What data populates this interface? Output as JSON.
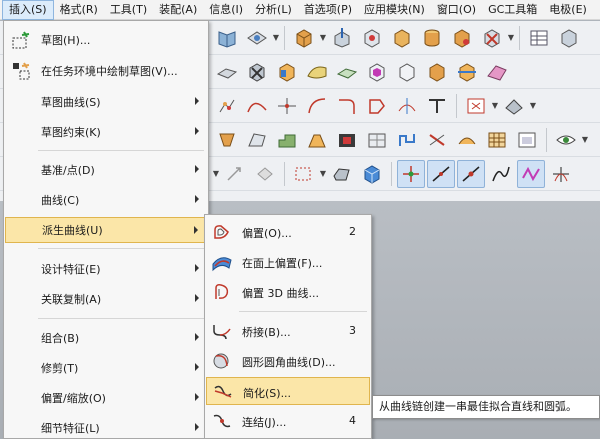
{
  "menubar": {
    "items": [
      "插入(S)",
      "格式(R)",
      "工具(T)",
      "装配(A)",
      "信息(I)",
      "分析(L)",
      "首选项(P)",
      "应用模块(N)",
      "窗口(O)",
      "GC工具箱",
      "电极(E)"
    ]
  },
  "insert_menu": {
    "items": [
      {
        "label": "草图(H)...",
        "icon": "sketch-icon"
      },
      {
        "label": "在任务环境中绘制草图(V)...",
        "icon": "task-sketch-icon"
      },
      {
        "label": "草图曲线(S)",
        "icon": ""
      },
      {
        "label": "草图约束(K)",
        "icon": ""
      },
      {
        "label": "基准/点(D)",
        "icon": ""
      },
      {
        "label": "曲线(C)",
        "icon": ""
      },
      {
        "label": "派生曲线(U)",
        "icon": ""
      },
      {
        "label": "设计特征(E)",
        "icon": ""
      },
      {
        "label": "关联复制(A)",
        "icon": ""
      },
      {
        "label": "组合(B)",
        "icon": ""
      },
      {
        "label": "修剪(T)",
        "icon": ""
      },
      {
        "label": "偏置/缩放(O)",
        "icon": ""
      },
      {
        "label": "细节特征(L)",
        "icon": ""
      }
    ]
  },
  "derived_curve_menu": {
    "items": [
      {
        "label": "偏置(O)...",
        "shortcut": "2",
        "icon": "offset-curve-icon"
      },
      {
        "label": "在面上偏置(F)...",
        "shortcut": "",
        "icon": "offset-in-face-icon"
      },
      {
        "label": "偏置 3D 曲线...",
        "shortcut": "",
        "icon": "offset-3d-curve-icon"
      },
      {
        "label": "桥接(B)...",
        "shortcut": "3",
        "icon": "bridge-curve-icon"
      },
      {
        "label": "圆形圆角曲线(D)...",
        "shortcut": "",
        "icon": "circular-fillet-curve-icon"
      },
      {
        "label": "简化(S)...",
        "shortcut": "",
        "icon": "simplify-curve-icon"
      },
      {
        "label": "连结(J)...",
        "shortcut": "4",
        "icon": "join-curve-icon"
      }
    ]
  },
  "tooltip": {
    "text": "从曲线链创建一串最佳拟合直线和圆弧。"
  }
}
